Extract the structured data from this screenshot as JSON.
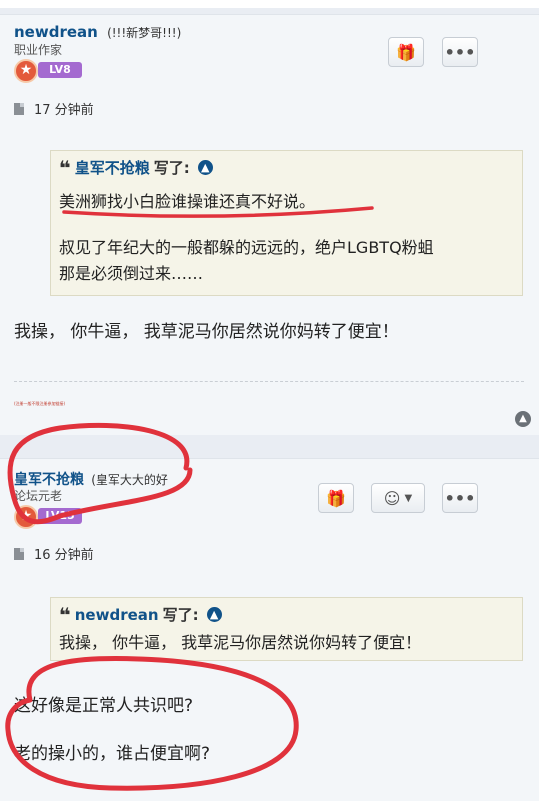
{
  "post1": {
    "username": "newdrean",
    "user_title": "(!!!新梦哥!!!)",
    "rank": "职业作家",
    "level": "LV8",
    "time": "17 分钟前",
    "quote": {
      "author": "皇军不抢粮",
      "says": "写了:",
      "lines": [
        "美洲狮找小白脸谁操谁还真不好说。",
        "叔见了年纪大的一般都躲的远远的，绝户LGBTQ粉蛆",
        "那是必须倒过来……"
      ]
    },
    "body": "我操， 你牛逼， 我草泥马你居然说你妈转了便宜！",
    "signature": "(注册一般不限注册参加链接)"
  },
  "post2": {
    "username": "皇军不抢粮",
    "user_title": "(皇军大大的好",
    "rank": "论坛元老",
    "level": "LV15",
    "time": "16 分钟前",
    "quote": {
      "author": "newdrean",
      "says": "写了:",
      "lines": [
        "我操， 你牛逼， 我草泥马你居然说你妈转了便宜！"
      ]
    },
    "body_lines": [
      "这好像是正常人共识吧?",
      "老的操小的，谁占便宜啊?"
    ]
  },
  "icons": {
    "gift": "gift-icon",
    "more": "more-icon",
    "reaction": "smiley-icon",
    "up": "up-arrow-icon",
    "doc": "post-icon"
  },
  "colors": {
    "username": "#105289",
    "level_badge": "#a46ad0",
    "annotation": "#e0323c"
  }
}
